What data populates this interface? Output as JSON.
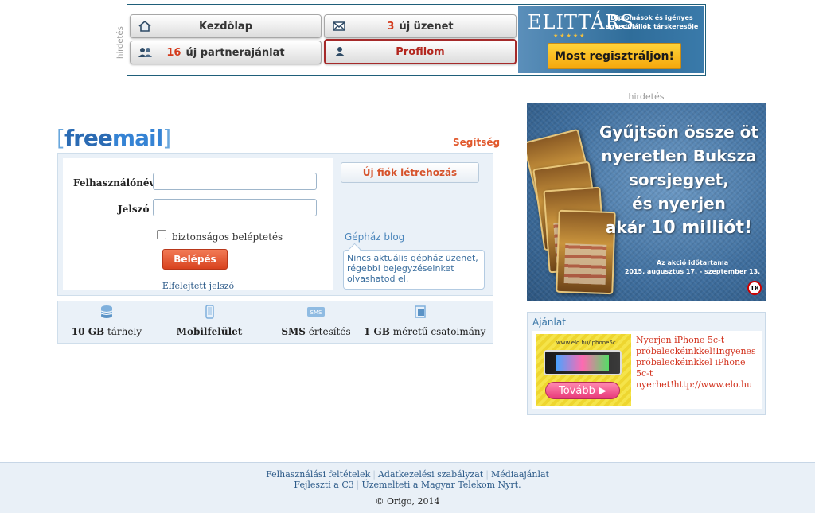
{
  "top_banner": {
    "side_label": "hirdetés",
    "buttons": [
      {
        "label": "Kezdőlap",
        "number": "",
        "icon": "home-icon"
      },
      {
        "label": "új üzenet",
        "number": "3",
        "icon": "envelope-icon"
      },
      {
        "label": "új partnerajánlat",
        "number": "16",
        "icon": "people-icon"
      },
      {
        "label": "Profilom",
        "number": "",
        "icon": "person-icon"
      }
    ],
    "elittars": {
      "logo": "ELITTÁRS",
      "tagline": "Diplomások és igényes egyedülállók társkeresője",
      "cta": "Most regisztráljon!"
    }
  },
  "right_ad": {
    "label": "hirdetés",
    "headline_lines": [
      "Gyűjtsön össze öt",
      "nyeretlen Buksza",
      "sorsjegyet,",
      "és nyerjen",
      "akár"
    ],
    "amount": "10 milliót!",
    "period_label": "Az akció időtartama",
    "period": "2015. augusztus 17. - szeptember 13.",
    "age": "18"
  },
  "offer": {
    "title": "Ajánlat",
    "image_url_text": "www.elo.hu/iphone5c",
    "image_button": "Tovább",
    "text": "Nyerjen iPhone 5c-t próbaleckéinkkel!Ingyenes próbaleckéinkkel iPhone 5c-t nyerhet!http://www.elo.hu"
  },
  "login": {
    "logo_bracket_open": "[",
    "logo_free": "free",
    "logo_mail": "mail",
    "logo_bracket_close": "]",
    "help": "Segítség",
    "username_label": "Felhasználónév",
    "username_value": "",
    "password_label": "Jelszó",
    "password_value": "",
    "secure_label": "biztonságos beléptetés",
    "secure_checked": false,
    "login_button": "Belépés",
    "forgot": "Elfelejtett jelszó",
    "new_account": "Új fiók létrehozás",
    "blog_title": "Gépház blog",
    "blog_text": "Nincs aktuális gépház üzenet, régebbi bejegyzéseinket olvashatod el."
  },
  "features": [
    {
      "bold": "10 GB",
      "rest": " tárhely",
      "icon": "database-icon"
    },
    {
      "bold": "Mobilfelület",
      "rest": "",
      "icon": "mobile-icon"
    },
    {
      "bold": "SMS",
      "rest": " értesítés",
      "icon": "sms-icon"
    },
    {
      "bold": "1 GB",
      "rest": " méretű csatolmány",
      "icon": "attachment-icon"
    }
  ],
  "footer": {
    "links_row1": [
      "Felhasználási feltételek",
      "Adatkezelési szabályzat",
      "Médiaajánlat"
    ],
    "links_row2": [
      "Fejleszti a C3",
      "Üzemelteti a Magyar Telekom Nyrt."
    ],
    "copyright": "© Origo, 2014"
  }
}
